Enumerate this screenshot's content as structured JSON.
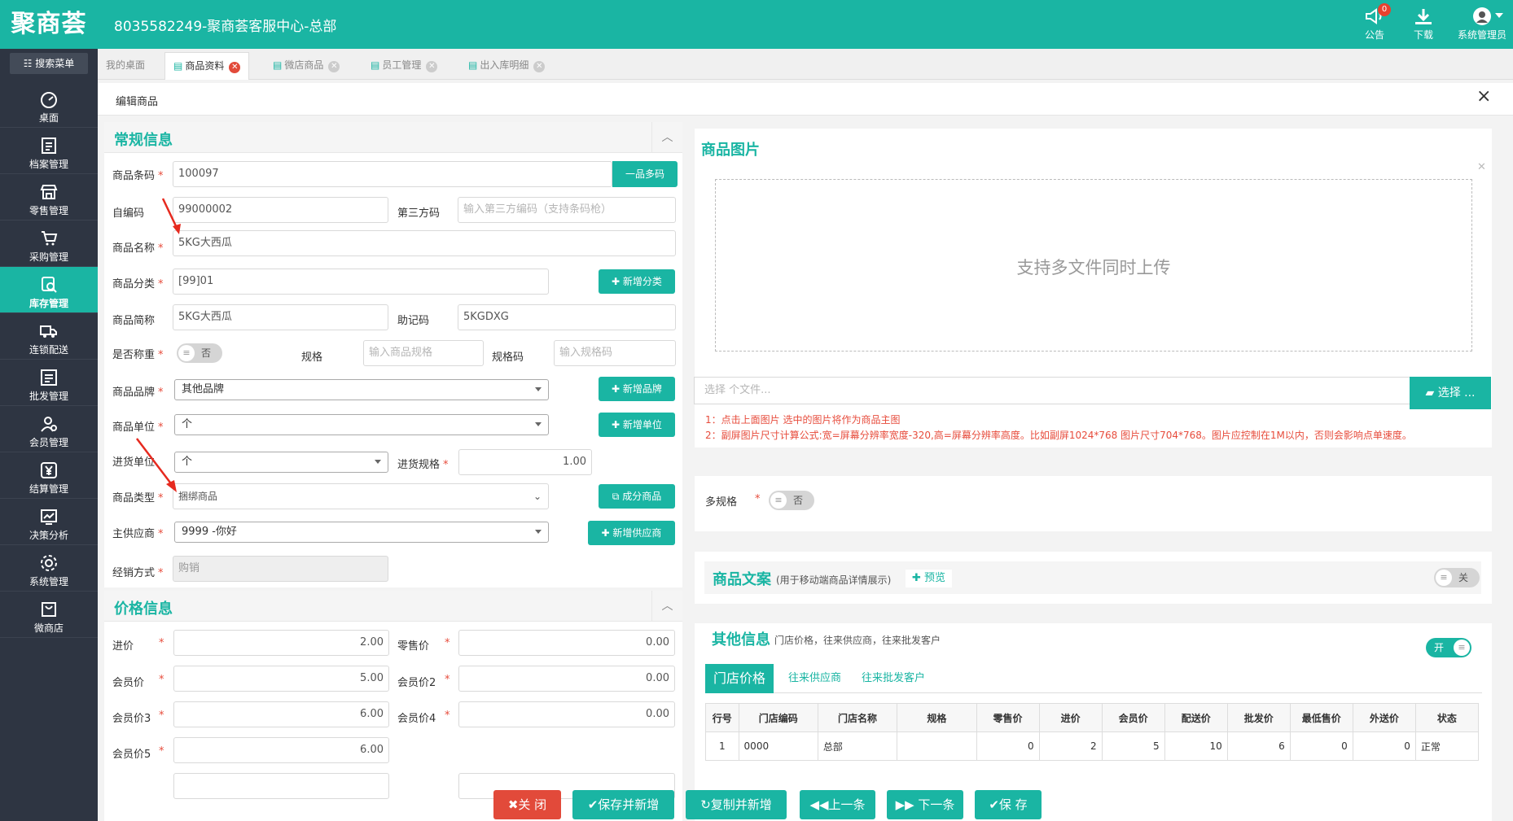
{
  "app": {
    "logo": "聚商荟",
    "title": "8035582249-聚商荟客服中心-总部"
  },
  "topbar": {
    "notice_label": "公告",
    "notice_count": "0",
    "download_label": "下载",
    "user_label": "系统管理员"
  },
  "sidebar": {
    "search_label": "搜索菜单",
    "items": [
      {
        "label": "桌面",
        "icon": "dashboard-icon"
      },
      {
        "label": "档案管理",
        "icon": "archive-icon"
      },
      {
        "label": "零售管理",
        "icon": "store-icon"
      },
      {
        "label": "采购管理",
        "icon": "cart-icon"
      },
      {
        "label": "库存管理",
        "icon": "inventory-icon",
        "active": true
      },
      {
        "label": "连锁配送",
        "icon": "truck-icon"
      },
      {
        "label": "批发管理",
        "icon": "wholesale-icon"
      },
      {
        "label": "会员管理",
        "icon": "member-icon"
      },
      {
        "label": "结算管理",
        "icon": "yen-icon"
      },
      {
        "label": "决策分析",
        "icon": "chart-icon"
      },
      {
        "label": "系统管理",
        "icon": "gear-icon"
      },
      {
        "label": "微商店",
        "icon": "shop-bag-icon"
      }
    ]
  },
  "tabs": [
    {
      "label": "我的桌面"
    },
    {
      "label": "商品资料",
      "active": true
    },
    {
      "label": "微店商品"
    },
    {
      "label": "员工管理"
    },
    {
      "label": "出入库明细"
    }
  ],
  "page": {
    "title": "编辑商品"
  },
  "general": {
    "title": "常规信息",
    "barcode_label": "商品条码",
    "barcode": "100097",
    "multi_code_btn": "一品多码",
    "self_code_label": "自编码",
    "self_code": "99000002",
    "third_code_label": "第三方码",
    "third_code_placeholder": "输入第三方编码（支持条码枪）",
    "name_label": "商品名称",
    "name": "5KG大西瓜",
    "category_label": "商品分类",
    "category": "[99]01",
    "add_category_btn": "新增分类",
    "short_name_label": "商品简称",
    "short_name": "5KG大西瓜",
    "mnemonic_label": "助记码",
    "mnemonic": "5KGDXG",
    "weigh_label": "是否称重",
    "weigh_value": "否",
    "spec_label": "规格",
    "spec_placeholder": "输入商品规格",
    "spec_code_label": "规格码",
    "spec_code_placeholder": "输入规格码",
    "brand_label": "商品品牌",
    "brand": "其他品牌",
    "add_brand_btn": "新增品牌",
    "unit_label": "商品单位",
    "unit": "个",
    "add_unit_btn": "新增单位",
    "purchase_unit_label": "进货单位",
    "purchase_unit": "个",
    "purchase_spec_label": "进货规格",
    "purchase_spec": "1.00",
    "type_label": "商品类型",
    "type": "捆绑商品",
    "component_btn": "成分商品",
    "supplier_label": "主供应商",
    "supplier": "9999 -你好",
    "add_supplier_btn": "新增供应商",
    "mode_label": "经销方式",
    "mode": "购销"
  },
  "price": {
    "title": "价格信息",
    "rows": [
      {
        "l1": "进价",
        "v1": "2.00",
        "l2": "零售价",
        "v2": "0.00"
      },
      {
        "l1": "会员价",
        "v1": "5.00",
        "l2": "会员价2",
        "v2": "0.00"
      },
      {
        "l1": "会员价3",
        "v1": "6.00",
        "l2": "会员价4",
        "v2": "0.00"
      },
      {
        "l1": "会员价5",
        "v1": "6.00"
      }
    ]
  },
  "image": {
    "title": "商品图片",
    "upload_text": "支持多文件同时上传",
    "file_placeholder": "选择 个文件...",
    "choose_btn": "选择 ...",
    "note1": "1：点击上面图片 选中的图片将作为商品主图",
    "note2": "2：副屏图片尺寸计算公式:宽=屏幕分辨率宽度-320,高=屏幕分辨率高度。比如副屏1024*768 图片尺寸704*768。图片应控制在1M以内，否则会影响点单速度。"
  },
  "multi_spec": {
    "label": "多规格",
    "value": "否"
  },
  "copywriting": {
    "title": "商品文案",
    "subtitle": "(用于移动端商品详情展示)",
    "preview": "预览",
    "toggle": "关"
  },
  "other": {
    "title": "其他信息",
    "subtitle": "门店价格，往来供应商，往来批发客户",
    "toggle": "开",
    "tabs": [
      {
        "label": "门店价格",
        "active": true
      },
      {
        "label": "往来供应商"
      },
      {
        "label": "往来批发客户"
      }
    ],
    "columns": [
      "行号",
      "门店编码",
      "门店名称",
      "规格",
      "零售价",
      "进价",
      "会员价",
      "配送价",
      "批发价",
      "最低售价",
      "外送价",
      "状态"
    ],
    "rows": [
      [
        "1",
        "0000",
        "总部",
        "",
        "0",
        "2",
        "5",
        "10",
        "6",
        "0",
        "0",
        "正常"
      ]
    ]
  },
  "footer": {
    "close": "关 闭",
    "save_new": "保存并新增",
    "copy_new": "复制并新增",
    "prev": "上一条",
    "next": "下一条",
    "save": "保 存"
  },
  "colors": {
    "brand": "#1ab5a3",
    "sidebar": "#2e3542",
    "danger": "#e24a3a"
  }
}
